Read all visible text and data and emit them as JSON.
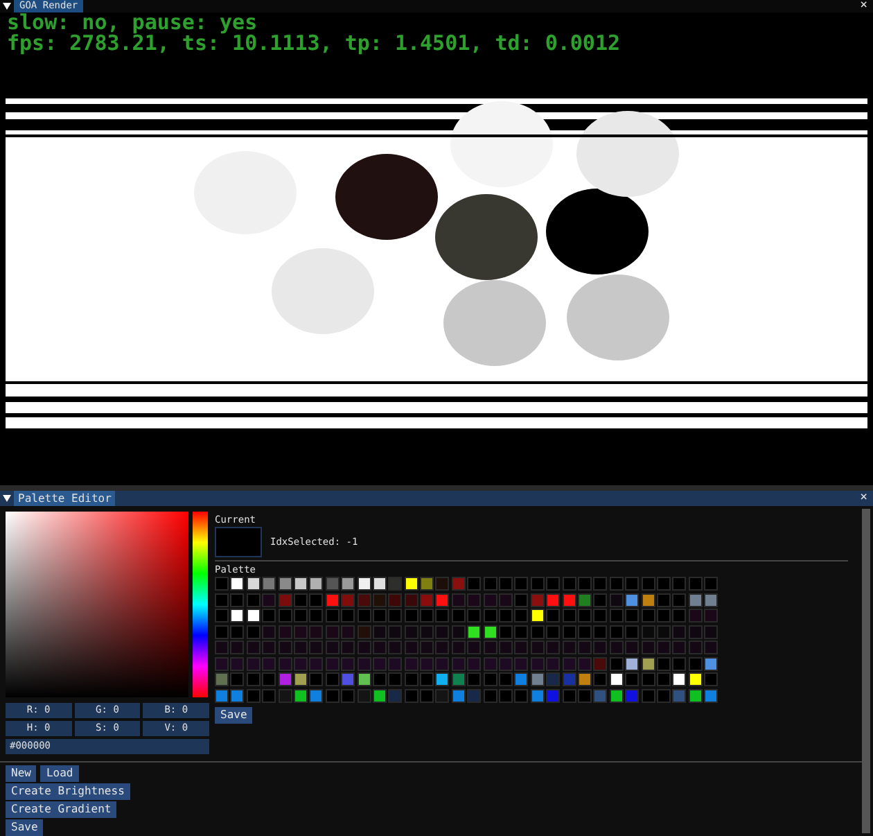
{
  "render_window": {
    "title": "GOA Render",
    "close": "×",
    "status_lines": [
      "slow: no, pause: yes",
      "fps: 2783.21, ts: 10.1113, tp: 1.4501, td: 0.0012"
    ]
  },
  "palette_editor": {
    "title": "Palette Editor",
    "close": "×",
    "picker": {
      "fields": [
        {
          "label": "R:",
          "value": "0"
        },
        {
          "label": "G:",
          "value": "0"
        },
        {
          "label": "B:",
          "value": "0"
        },
        {
          "label": "H:",
          "value": "0"
        },
        {
          "label": "S:",
          "value": "0"
        },
        {
          "label": "V:",
          "value": "0"
        }
      ],
      "hex": "#000000"
    },
    "buttons_row": [
      "New",
      "Load"
    ],
    "buttons": [
      "Create Brightness",
      "Create Gradient",
      "Save"
    ],
    "current": {
      "label": "Current",
      "color": "#000000",
      "idx_text": "IdxSelected: -1"
    },
    "palette": {
      "label": "Palette",
      "save": "Save",
      "rows": [
        [
          {
            "color": "#000000"
          },
          {
            "color": "#ffffff"
          },
          {
            "color": "#d8d8d8"
          },
          {
            "color": "#777777"
          },
          {
            "color": "#8a8a8a"
          },
          {
            "color": "#c8c8c8"
          },
          {
            "color": "#b0b0b0"
          },
          {
            "color": "#555555"
          },
          {
            "color": "#9a9a9a"
          },
          {
            "color": "#f0f0f0"
          },
          {
            "color": "#e0e0e0"
          },
          {
            "color": "#2e2e2a"
          },
          {
            "color": "#ffff00"
          },
          {
            "color": "#808010"
          },
          {
            "color": "#1e0e0a"
          },
          {
            "color": "#8a1010"
          },
          {
            "color": "#000000"
          },
          {
            "color": "#000000"
          },
          {
            "color": "#000000"
          },
          {
            "color": "#000000"
          },
          {
            "color": "#000000"
          },
          {
            "color": "#000000"
          },
          {
            "color": "#000000"
          },
          {
            "color": "#000000"
          },
          {
            "color": "#000000"
          },
          {
            "color": "#000000"
          },
          {
            "color": "#000000"
          },
          {
            "color": "#000000"
          },
          {
            "color": "#000000"
          },
          {
            "color": "#000000"
          },
          {
            "color": "#000000"
          },
          {
            "color": "#000000"
          }
        ],
        [
          {
            "color": "#000000"
          },
          {
            "color": "#000000"
          },
          {
            "color": "#000000"
          },
          {
            "color": "#1a0818"
          },
          {
            "color": "#7a0c0c"
          },
          {
            "color": "#000000"
          },
          {
            "color": "#000000"
          },
          {
            "color": "#ff1010"
          },
          {
            "color": "#800c0c"
          },
          {
            "color": "#4a0a0a"
          },
          {
            "color": "#201008"
          },
          {
            "color": "#3e0808"
          },
          {
            "color": "#3a0808"
          },
          {
            "color": "#8a0c0c"
          },
          {
            "color": "#ff1010"
          },
          {
            "color": "#1a0818"
          },
          {
            "color": "#1a0818"
          },
          {
            "color": "#1a0818"
          },
          {
            "color": "#1a0818"
          },
          {
            "color": "#000000"
          },
          {
            "color": "#8a1010"
          },
          {
            "color": "#ff1010"
          },
          {
            "color": "#ff1010"
          },
          {
            "color": "#208020"
          },
          {
            "color": "#000000"
          },
          {
            "color": "#100810"
          },
          {
            "color": "#5090e0"
          },
          {
            "color": "#c08010"
          },
          {
            "color": "#000000"
          },
          {
            "color": "#000000"
          },
          {
            "color": "#708090"
          },
          {
            "color": "#708090"
          }
        ],
        [
          {
            "color": "#000000"
          },
          {
            "color": "#ffffff"
          },
          {
            "color": "#ffffff"
          },
          {
            "color": "#000000"
          },
          {
            "color": "#000000"
          },
          {
            "color": "#000000"
          },
          {
            "color": "#000000"
          },
          {
            "color": "#000000"
          },
          {
            "color": "#000000"
          },
          {
            "color": "#000000"
          },
          {
            "color": "#000000"
          },
          {
            "color": "#000000"
          },
          {
            "color": "#000000"
          },
          {
            "color": "#000000"
          },
          {
            "color": "#000000"
          },
          {
            "color": "#000000"
          },
          {
            "color": "#000000"
          },
          {
            "color": "#000000"
          },
          {
            "color": "#000000"
          },
          {
            "color": "#000000"
          },
          {
            "color": "#ffff00"
          },
          {
            "color": "#000000"
          },
          {
            "color": "#000000"
          },
          {
            "color": "#000000"
          },
          {
            "color": "#000000"
          },
          {
            "color": "#000000"
          },
          {
            "color": "#000000"
          },
          {
            "color": "#000000"
          },
          {
            "color": "#000000"
          },
          {
            "color": "#000000"
          },
          {
            "color": "#1a0818"
          },
          {
            "color": "#1a0818"
          }
        ],
        [
          {
            "color": "#000000"
          },
          {
            "color": "#000000"
          },
          {
            "color": "#000000"
          },
          {
            "color": "#140814"
          },
          {
            "color": "#1a0818"
          },
          {
            "color": "#1a0818"
          },
          {
            "color": "#1a0818"
          },
          {
            "color": "#1a0818"
          },
          {
            "color": "#1a0818"
          },
          {
            "color": "#201008"
          },
          {
            "color": "#100810"
          },
          {
            "color": "#100810"
          },
          {
            "color": "#100810"
          },
          {
            "color": "#100810"
          },
          {
            "color": "#100810"
          },
          {
            "color": "#100810"
          },
          {
            "color": "#30e020"
          },
          {
            "color": "#30e020"
          },
          {
            "color": "#000000"
          },
          {
            "color": "#000000"
          },
          {
            "color": "#000000"
          },
          {
            "color": "#000000"
          },
          {
            "color": "#000000"
          },
          {
            "color": "#000000"
          },
          {
            "color": "#000000"
          },
          {
            "color": "#000000"
          },
          {
            "color": "#000000"
          },
          {
            "color": "#0a0a0a"
          },
          {
            "color": "#0a0a0a"
          },
          {
            "color": "#100810"
          },
          {
            "color": "#100810"
          },
          {
            "color": "#100810"
          }
        ],
        [
          {
            "color": "#140814"
          },
          {
            "color": "#140814"
          },
          {
            "color": "#140814"
          },
          {
            "color": "#140814"
          },
          {
            "color": "#140814"
          },
          {
            "color": "#140814"
          },
          {
            "color": "#140814"
          },
          {
            "color": "#140814"
          },
          {
            "color": "#140814"
          },
          {
            "color": "#140814"
          },
          {
            "color": "#140814"
          },
          {
            "color": "#140814"
          },
          {
            "color": "#140814"
          },
          {
            "color": "#140814"
          },
          {
            "color": "#140814"
          },
          {
            "color": "#140814"
          },
          {
            "color": "#140814"
          },
          {
            "color": "#140814"
          },
          {
            "color": "#140814"
          },
          {
            "color": "#140814"
          },
          {
            "color": "#140814"
          },
          {
            "color": "#140814"
          },
          {
            "color": "#140814"
          },
          {
            "color": "#140814"
          },
          {
            "color": "#140814"
          },
          {
            "color": "#140814"
          },
          {
            "color": "#140814"
          },
          {
            "color": "#140814"
          },
          {
            "color": "#140814"
          },
          {
            "color": "#140814"
          },
          {
            "color": "#140814"
          },
          {
            "color": "#140814"
          }
        ],
        [
          {
            "color": "#1e0a22"
          },
          {
            "color": "#1e0a22"
          },
          {
            "color": "#1e0a22"
          },
          {
            "color": "#1e0a22"
          },
          {
            "color": "#1e0a22"
          },
          {
            "color": "#1e0a22"
          },
          {
            "color": "#1e0a22"
          },
          {
            "color": "#1e0a22"
          },
          {
            "color": "#1e0a22"
          },
          {
            "color": "#1e0a22"
          },
          {
            "color": "#1e0a22"
          },
          {
            "color": "#1e0a22"
          },
          {
            "color": "#1e0a22"
          },
          {
            "color": "#1e0a22"
          },
          {
            "color": "#1e0a22"
          },
          {
            "color": "#1e0a22"
          },
          {
            "color": "#1e0a22"
          },
          {
            "color": "#1e0a22"
          },
          {
            "color": "#1e0a22"
          },
          {
            "color": "#1e0a22"
          },
          {
            "color": "#1e0a22"
          },
          {
            "color": "#1e0a22"
          },
          {
            "color": "#1e0a22"
          },
          {
            "color": "#1e0a22"
          },
          {
            "color": "#4a0a0a"
          },
          {
            "color": "#000000"
          },
          {
            "color": "#a0b0d8"
          },
          {
            "color": "#a0a050"
          },
          {
            "color": "#000000"
          },
          {
            "color": "#000000"
          },
          {
            "color": "#000000"
          },
          {
            "color": "#5090e0"
          }
        ],
        [
          {
            "color": "#607050"
          },
          {
            "color": "#000000"
          },
          {
            "color": "#000000"
          },
          {
            "color": "#000000"
          },
          {
            "color": "#b020e0"
          },
          {
            "color": "#a0a050"
          },
          {
            "color": "#000000"
          },
          {
            "color": "#000000"
          },
          {
            "color": "#5050e0"
          },
          {
            "color": "#60c050"
          },
          {
            "color": "#000000"
          },
          {
            "color": "#000000"
          },
          {
            "color": "#000000"
          },
          {
            "color": "#000000"
          },
          {
            "color": "#10b0f0"
          },
          {
            "color": "#108050"
          },
          {
            "color": "#000000"
          },
          {
            "color": "#000000"
          },
          {
            "color": "#000000"
          },
          {
            "color": "#1080e0"
          },
          {
            "color": "#708090"
          },
          {
            "color": "#182848"
          },
          {
            "color": "#1830a0"
          },
          {
            "color": "#c08010"
          },
          {
            "color": "#000000"
          },
          {
            "color": "#ffffff"
          },
          {
            "color": "#000000"
          },
          {
            "color": "#000000"
          },
          {
            "color": "#000000"
          },
          {
            "color": "#ffffff"
          },
          {
            "color": "#ffff00"
          },
          {
            "color": "#000000"
          }
        ],
        [
          {
            "color": "#1080e0"
          },
          {
            "color": "#1080e0"
          },
          {
            "color": "#000000"
          },
          {
            "color": "#000000"
          },
          {
            "color": "#141414"
          },
          {
            "color": "#10c020"
          },
          {
            "color": "#1080e0"
          },
          {
            "color": "#000000"
          },
          {
            "color": "#000000"
          },
          {
            "color": "#141414"
          },
          {
            "color": "#10c020"
          },
          {
            "color": "#182848"
          },
          {
            "color": "#000000"
          },
          {
            "color": "#000000"
          },
          {
            "color": "#141414"
          },
          {
            "color": "#1080e0"
          },
          {
            "color": "#182848"
          },
          {
            "color": "#000000"
          },
          {
            "color": "#000000"
          },
          {
            "color": "#000000"
          },
          {
            "color": "#1080e0"
          },
          {
            "color": "#1010e0"
          },
          {
            "color": "#000000"
          },
          {
            "color": "#000000"
          },
          {
            "color": "#305080"
          },
          {
            "color": "#10c020"
          },
          {
            "color": "#1010e0"
          },
          {
            "color": "#000000"
          },
          {
            "color": "#000000"
          },
          {
            "color": "#305080"
          },
          {
            "color": "#10c020"
          },
          {
            "color": "#1080e0"
          }
        ]
      ]
    }
  }
}
